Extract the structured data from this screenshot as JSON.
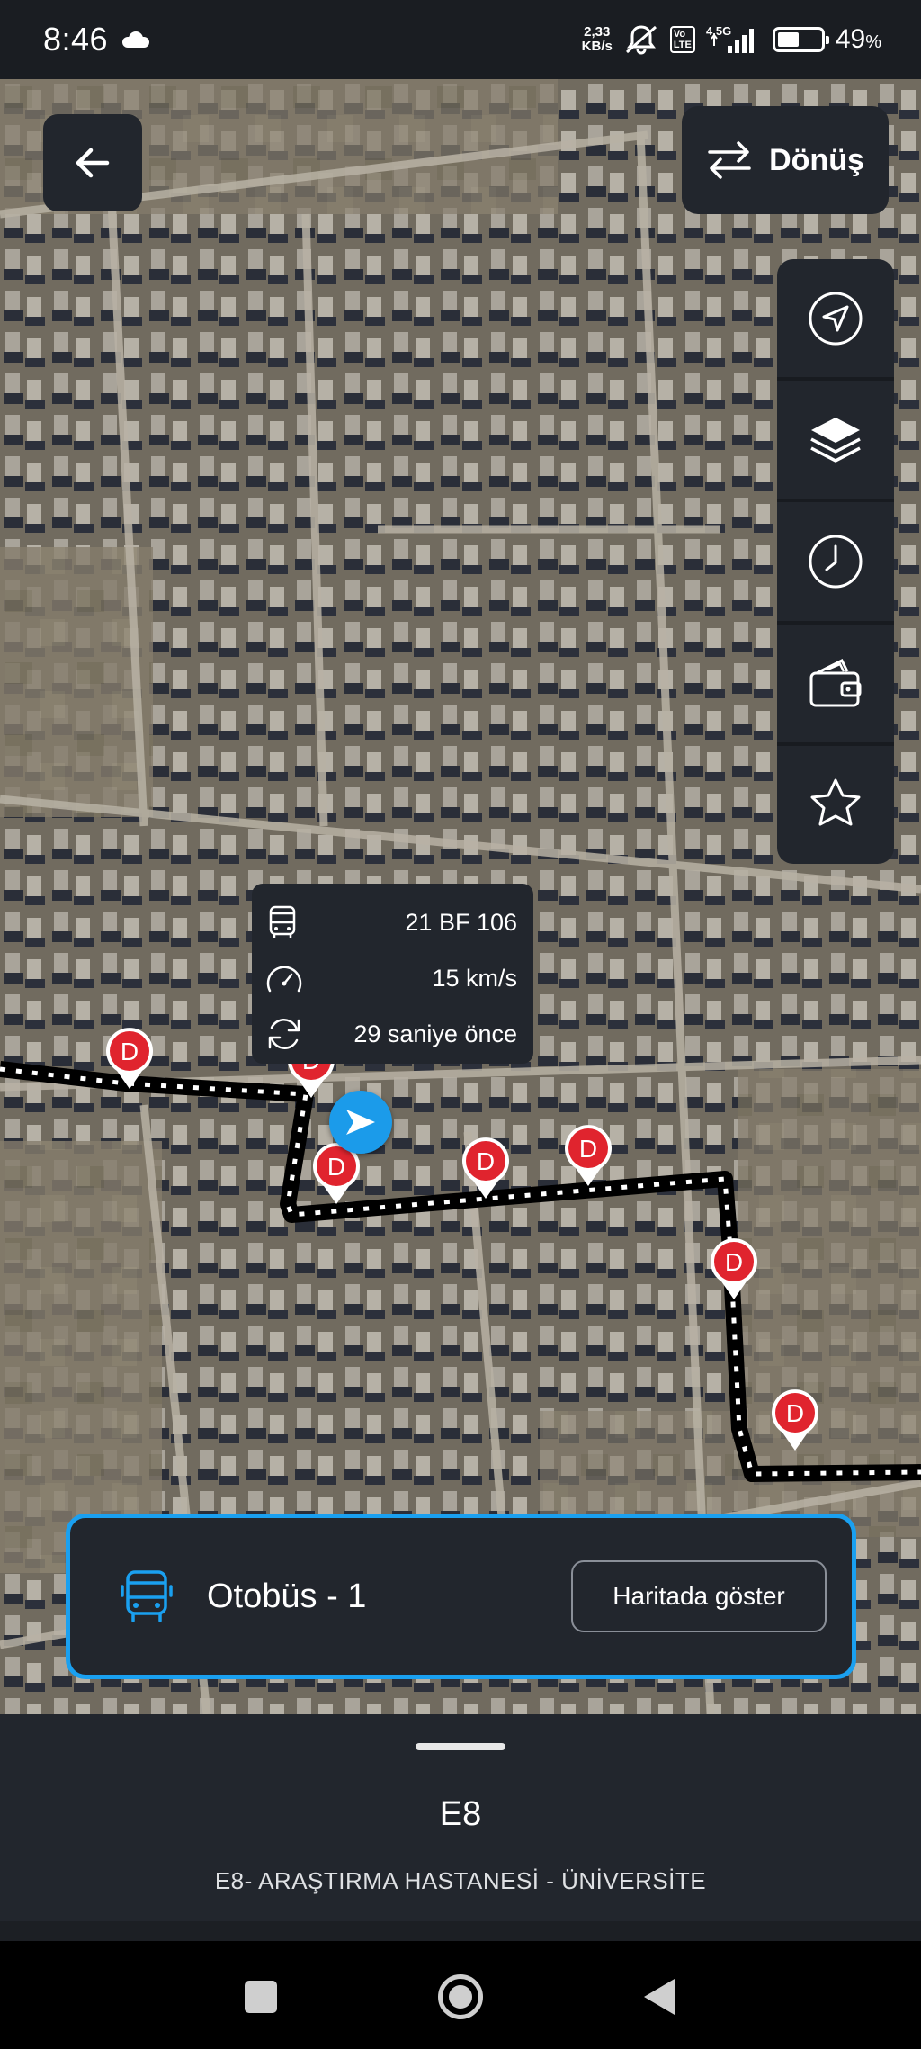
{
  "status_bar": {
    "time": "8:46",
    "net_speed_value": "2,33",
    "net_speed_unit": "KB/s",
    "network_label": "4.5G",
    "volte_label": "Vo\nLTE",
    "battery_percent": "49",
    "battery_percent_sign": "%",
    "battery_level": 0.49
  },
  "header": {
    "back_icon": "arrow-left-icon",
    "donus_label": "Dönüş",
    "donus_icon": "swap-arrows-icon"
  },
  "side_controls": [
    {
      "icon": "location-arrow-icon"
    },
    {
      "icon": "layers-icon"
    },
    {
      "icon": "clock-icon"
    },
    {
      "icon": "wallet-icon"
    },
    {
      "icon": "star-icon"
    }
  ],
  "vehicle_popup": {
    "plate": "21 BF 106",
    "speed": "15 km/s",
    "updated": "29 saniye önce"
  },
  "stop_marker_label": "D",
  "bus_card": {
    "title": "Otobüs - 1",
    "button_label": "Haritada göster"
  },
  "route": {
    "code": "E8",
    "name": "E8- ARAŞTIRMA HASTANESİ - ÜNİVERSİTE"
  },
  "colors": {
    "accent": "#1aa0f0",
    "panel": "#22262d",
    "stop_marker": "#e0242e"
  }
}
